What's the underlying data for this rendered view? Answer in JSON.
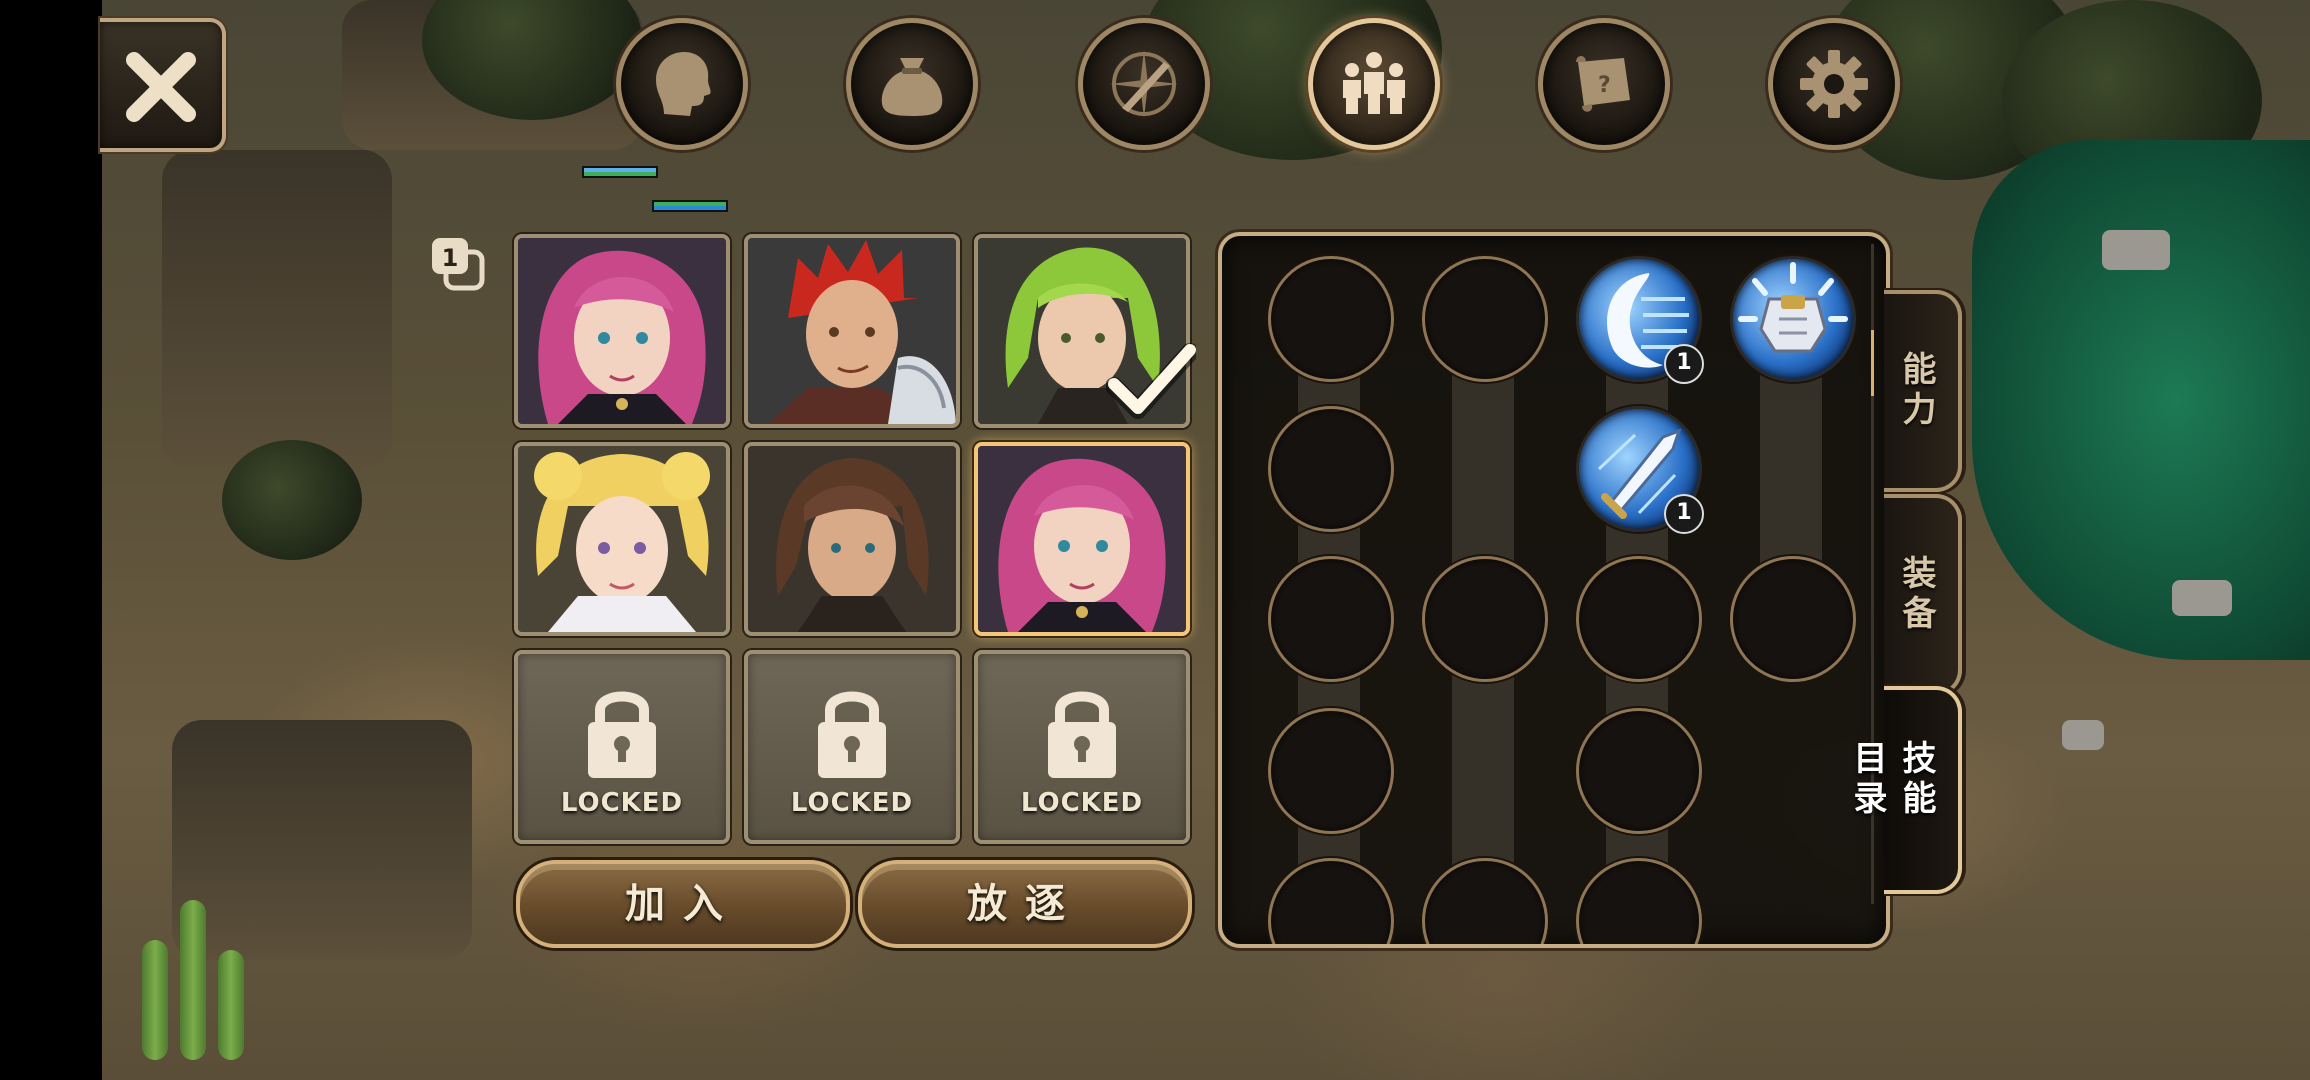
{
  "top_menu": {
    "close_icon": "close-icon",
    "buttons": [
      {
        "name": "character",
        "icon": "head-icon"
      },
      {
        "name": "inventory",
        "icon": "bag-icon"
      },
      {
        "name": "map",
        "icon": "compass-sword-icon"
      },
      {
        "name": "party",
        "icon": "party-icon",
        "active": true
      },
      {
        "name": "quest",
        "icon": "scroll-icon"
      },
      {
        "name": "settings",
        "icon": "gear-icon"
      }
    ]
  },
  "party": {
    "count_badge": "1",
    "members": [
      {
        "portrait": "pink-haired-woman",
        "selected": false
      },
      {
        "portrait": "red-haired-knight",
        "selected": false
      },
      {
        "portrait": "green-haired-man",
        "selected": false,
        "checked": true
      },
      {
        "portrait": "blonde-woman",
        "selected": false
      },
      {
        "portrait": "brown-haired-man",
        "selected": false
      },
      {
        "portrait": "pink-haired-woman",
        "selected": true
      }
    ],
    "locked_label": "LOCKED",
    "locked_slots": 3,
    "join_button": "加入",
    "expel_button": "放逐"
  },
  "skill_panel": {
    "skills": [
      {
        "icon": "crescent-slash-skill-icon",
        "level": "1"
      },
      {
        "icon": "armor-burst-skill-icon",
        "level": ""
      },
      {
        "icon": "blade-skill-icon",
        "level": "1"
      }
    ]
  },
  "side_tabs": [
    {
      "label": "能力",
      "active": false
    },
    {
      "label": "装备",
      "active": false
    },
    {
      "label": "技能目录",
      "active": true
    }
  ],
  "colors": {
    "frame_gold": "#c7ad86",
    "selected_gold": "#f3c777",
    "button_brown": "#6a4e2c",
    "skill_blue": "#2a70c8"
  }
}
